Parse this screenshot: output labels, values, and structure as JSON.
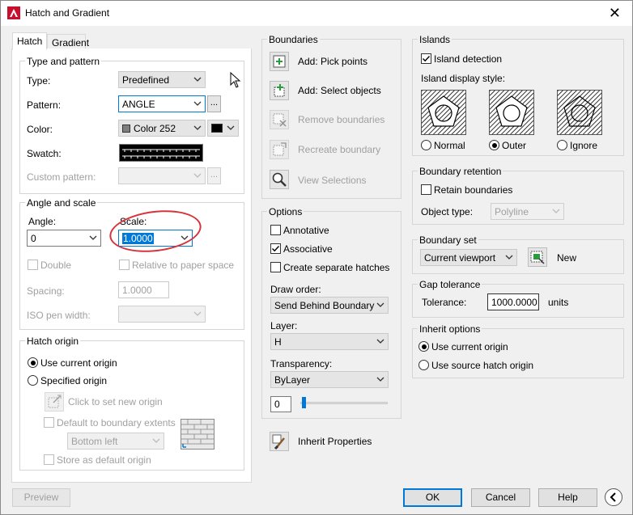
{
  "window": {
    "title": "Hatch and Gradient",
    "close_glyph": "✕",
    "app_icon": "autocad-logo-icon"
  },
  "tabs": [
    {
      "label": "Hatch"
    },
    {
      "label": "Gradient"
    }
  ],
  "type_pattern": {
    "group_label": "Type and pattern",
    "type_label": "Type:",
    "type_value": "Predefined",
    "pattern_label": "Pattern:",
    "pattern_value": "ANGLE",
    "pattern_browse": "...",
    "color_label": "Color:",
    "color_value": "Color 252",
    "color_swatch": "#7f7f7f",
    "bg_color_swatch": "#000000",
    "swatch_label": "Swatch:",
    "custom_pattern_label": "Custom pattern:",
    "custom_pattern_browse": "..."
  },
  "angle_scale": {
    "group_label": "Angle and scale",
    "angle_label": "Angle:",
    "angle_value": "0",
    "scale_label": "Scale:",
    "scale_value": "1.0000",
    "double_label": "Double",
    "relative_label": "Relative to paper space",
    "spacing_label": "Spacing:",
    "spacing_value": "1.0000",
    "iso_label": "ISO pen width:"
  },
  "hatch_origin": {
    "group_label": "Hatch origin",
    "use_current_label": "Use current origin",
    "specified_label": "Specified origin",
    "click_set_label": "Click to set new origin",
    "default_extents_label": "Default to boundary extents",
    "position_value": "Bottom left",
    "store_default_label": "Store as default origin"
  },
  "boundaries": {
    "group_label": "Boundaries",
    "add_pick": "Add: Pick points",
    "add_select": "Add: Select objects",
    "remove": "Remove boundaries",
    "recreate": "Recreate boundary",
    "view": "View Selections"
  },
  "options": {
    "group_label": "Options",
    "annotative_label": "Annotative",
    "associative_label": "Associative",
    "separate_label": "Create separate hatches",
    "draw_order_label": "Draw order:",
    "draw_order_value": "Send Behind Boundary",
    "layer_label": "Layer:",
    "layer_value": "H",
    "transparency_label": "Transparency:",
    "transparency_value": "ByLayer",
    "transparency_amount": "0",
    "transparency_level": 0.02
  },
  "inherit_btn_label": "Inherit Properties",
  "islands": {
    "group_label": "Islands",
    "detection_label": "Island detection",
    "style_label": "Island display style:",
    "normal_label": "Normal",
    "outer_label": "Outer",
    "ignore_label": "Ignore"
  },
  "boundary_retention": {
    "group_label": "Boundary retention",
    "retain_label": "Retain boundaries",
    "object_type_label": "Object type:",
    "object_type_value": "Polyline"
  },
  "boundary_set": {
    "group_label": "Boundary set",
    "value": "Current viewport",
    "new_label": "New"
  },
  "gap": {
    "group_label": "Gap tolerance",
    "tolerance_label": "Tolerance:",
    "tolerance_value": "1000.0000",
    "units_label": "units"
  },
  "inherit_options": {
    "group_label": "Inherit options",
    "use_current_label": "Use current origin",
    "use_source_label": "Use source hatch origin"
  },
  "footer": {
    "preview": "Preview",
    "ok": "OK",
    "cancel": "Cancel",
    "help": "Help"
  },
  "colors": {
    "accent": "#0078d7",
    "annotation": "#d6333a"
  }
}
